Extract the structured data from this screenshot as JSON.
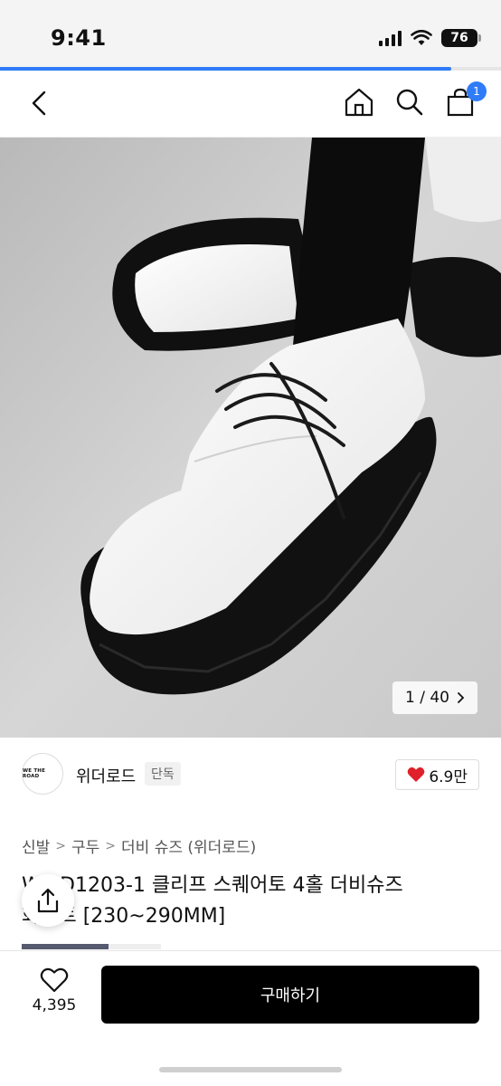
{
  "status_bar": {
    "time": "9:41",
    "battery": "76"
  },
  "load_progress_pct": 90,
  "nav": {
    "cart_count": "1"
  },
  "gallery": {
    "counter": "1 / 40"
  },
  "brand": {
    "logo_text": "WE THE ROAD",
    "name": "위더로드",
    "tag": "단독",
    "likes": "6.9만"
  },
  "breadcrumb": [
    "신발",
    "구두",
    "더비 슈즈 (위더로드)"
  ],
  "product": {
    "title_line1": "W   PD1203-1 클리프 스퀘어토 4홀 더비슈즈",
    "title_line2": "화이트 [230~290MM]"
  },
  "bottom": {
    "wish_count": "4,395",
    "buy_label": "구매하기"
  },
  "colors": {
    "accent": "#2f7cf6",
    "buy": "#000000",
    "heart": "#e0202a"
  }
}
